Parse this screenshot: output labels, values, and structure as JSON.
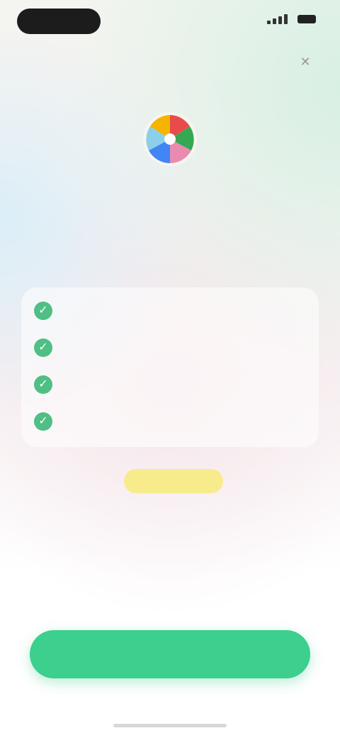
{
  "status_bar": {
    "time": "",
    "battery_icon": "battery-icon",
    "signal_icon": "signal-icon"
  },
  "header": {
    "close_icon": "close-icon"
  },
  "brand": {
    "logo_icon": "pinwheel-logo-icon",
    "colors": [
      "#e94b4b",
      "#f4b400",
      "#4285f4",
      "#34a853"
    ]
  },
  "hero": {
    "title": "",
    "subtitle": ""
  },
  "features": [
    {
      "text": ""
    },
    {
      "text": ""
    },
    {
      "text": ""
    },
    {
      "text": ""
    }
  ],
  "plans": [
    {
      "name": "",
      "price": ""
    },
    {
      "name": "",
      "price": "",
      "badge": ""
    },
    {
      "name": "",
      "price": ""
    }
  ],
  "cta": {
    "label": ""
  },
  "footer": {
    "restore_label": ""
  },
  "theme": {
    "accent": "#3ccf8e",
    "check": "#4fbf85",
    "badge": "#f8eb8c",
    "subtitle": "#d98a9a"
  }
}
